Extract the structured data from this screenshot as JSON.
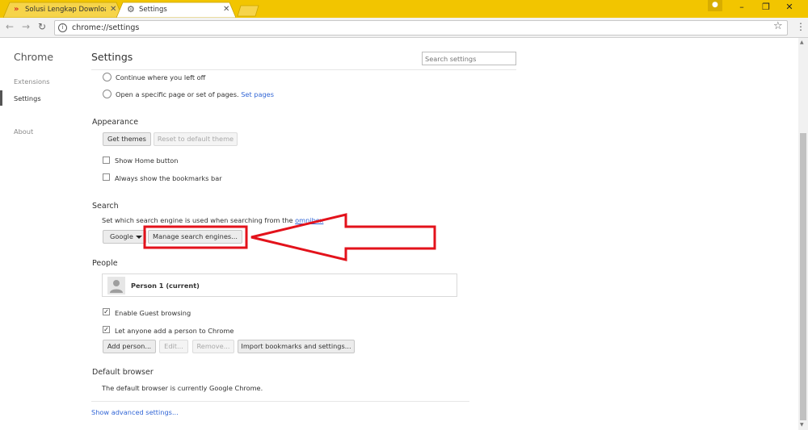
{
  "tabs": [
    {
      "title": "Solusi Lengkap Downloa",
      "active": false
    },
    {
      "title": "Settings",
      "active": true
    }
  ],
  "toolbar": {
    "url": "chrome://settings"
  },
  "sidebar": {
    "title": "Chrome",
    "items": [
      {
        "label": "Extensions",
        "active": false
      },
      {
        "label": "Settings",
        "active": true
      },
      {
        "label": "About",
        "active": false
      }
    ]
  },
  "header": {
    "title": "Settings",
    "search_placeholder": "Search settings"
  },
  "on_startup": {
    "continue_label": "Continue where you left off",
    "specific_pages_label": "Open a specific page or set of pages.",
    "set_pages_link": "Set pages"
  },
  "appearance": {
    "heading": "Appearance",
    "get_themes": "Get themes",
    "reset_theme": "Reset to default theme",
    "show_home_button": "Show Home button",
    "show_bookmarks_bar": "Always show the bookmarks bar"
  },
  "search": {
    "heading": "Search",
    "description": "Set which search engine is used when searching from the",
    "omnibox_link": "omnibox",
    "engine_selected": "Google",
    "manage_button": "Manage search engines..."
  },
  "people": {
    "heading": "People",
    "profile_name": "Person 1 (current)",
    "enable_guest": "Enable Guest browsing",
    "let_anyone_add": "Let anyone add a person to Chrome",
    "add_person": "Add person...",
    "edit": "Edit...",
    "remove": "Remove...",
    "import": "Import bookmarks and settings..."
  },
  "default_browser": {
    "heading": "Default browser",
    "status": "The default browser is currently Google Chrome."
  },
  "footer": {
    "advanced_link": "Show advanced settings..."
  },
  "colors": {
    "titlebar": "#f2c500",
    "link": "#3367d6",
    "annotation": "#e3121b"
  }
}
